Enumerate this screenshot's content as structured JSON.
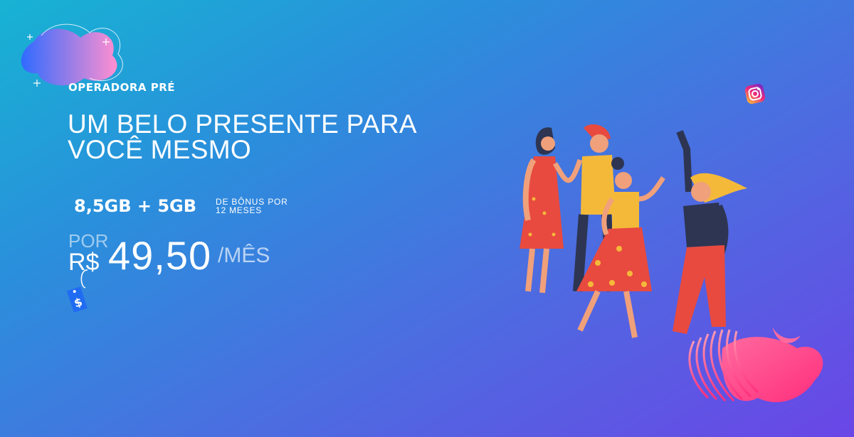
{
  "brand": {
    "eyebrow": "OPERADORA PRÉ"
  },
  "headline": {
    "line1": "UM BELO PRESENTE PARA",
    "line2": "VOCÊ MESMO"
  },
  "offer": {
    "data": "8,5GB + 5GB",
    "bonus_line1": "DE BÔNUS POR",
    "bonus_line2": "12 MESES"
  },
  "price": {
    "prefix": "POR",
    "currency": "R$",
    "value": "49,50",
    "unit": "/MÊS"
  },
  "icons": [
    "price-tag-icon",
    "instagram-icon",
    "sparkle-icon"
  ],
  "colors": {
    "gradient_start": "#17b3d3",
    "gradient_end": "#6a46e6",
    "accent_pink": "#ff3d8b",
    "dress_red": "#e84a3f",
    "shirt_yellow": "#f5b93a"
  }
}
